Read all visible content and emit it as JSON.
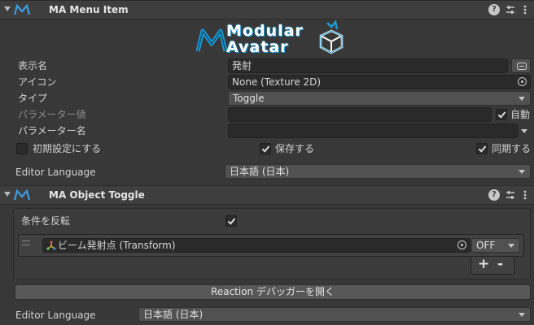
{
  "menu_item": {
    "title": "MA Menu Item",
    "logo_line1": "Modular",
    "logo_line2": "Avatar",
    "display_name_label": "表示名",
    "display_name_value": "発射",
    "icon_label": "アイコン",
    "icon_value": "None (Texture 2D)",
    "type_label": "タイプ",
    "type_value": "Toggle",
    "param_value_label": "パラメーター値",
    "auto_label": "自動",
    "auto_checked": true,
    "param_name_label": "パラメーター名",
    "param_name_value": "",
    "default_label": "初期設定にする",
    "default_checked": false,
    "saved_label": "保存する",
    "saved_checked": true,
    "synced_label": "同期する",
    "synced_checked": true,
    "editor_language_label": "Editor Language",
    "editor_language_value": "日本語 (日本)"
  },
  "object_toggle": {
    "title": "MA Object Toggle",
    "invert_label": "条件を反転",
    "invert_checked": true,
    "entries": [
      {
        "object": "ビーム発射点 (Transform)",
        "state": "OFF"
      }
    ],
    "add_label": "+",
    "remove_label": "-",
    "debugger_button": "Reaction デバッガーを開く",
    "editor_language_label": "Editor Language",
    "editor_language_value": "日本語 (日本)"
  },
  "colors": {
    "background": "#383838",
    "header": "#3e3e3e",
    "field": "#2a2a2a",
    "logo_blue": "#1e9bd7",
    "accent_icon": "#3aa0e6"
  },
  "icons": [
    "foldout-arrow-icon",
    "modular-avatar-icon",
    "help-icon",
    "presets-icon",
    "context-menu-icon",
    "link-icon",
    "object-picker-icon",
    "drag-handle-icon",
    "transform-icon"
  ]
}
